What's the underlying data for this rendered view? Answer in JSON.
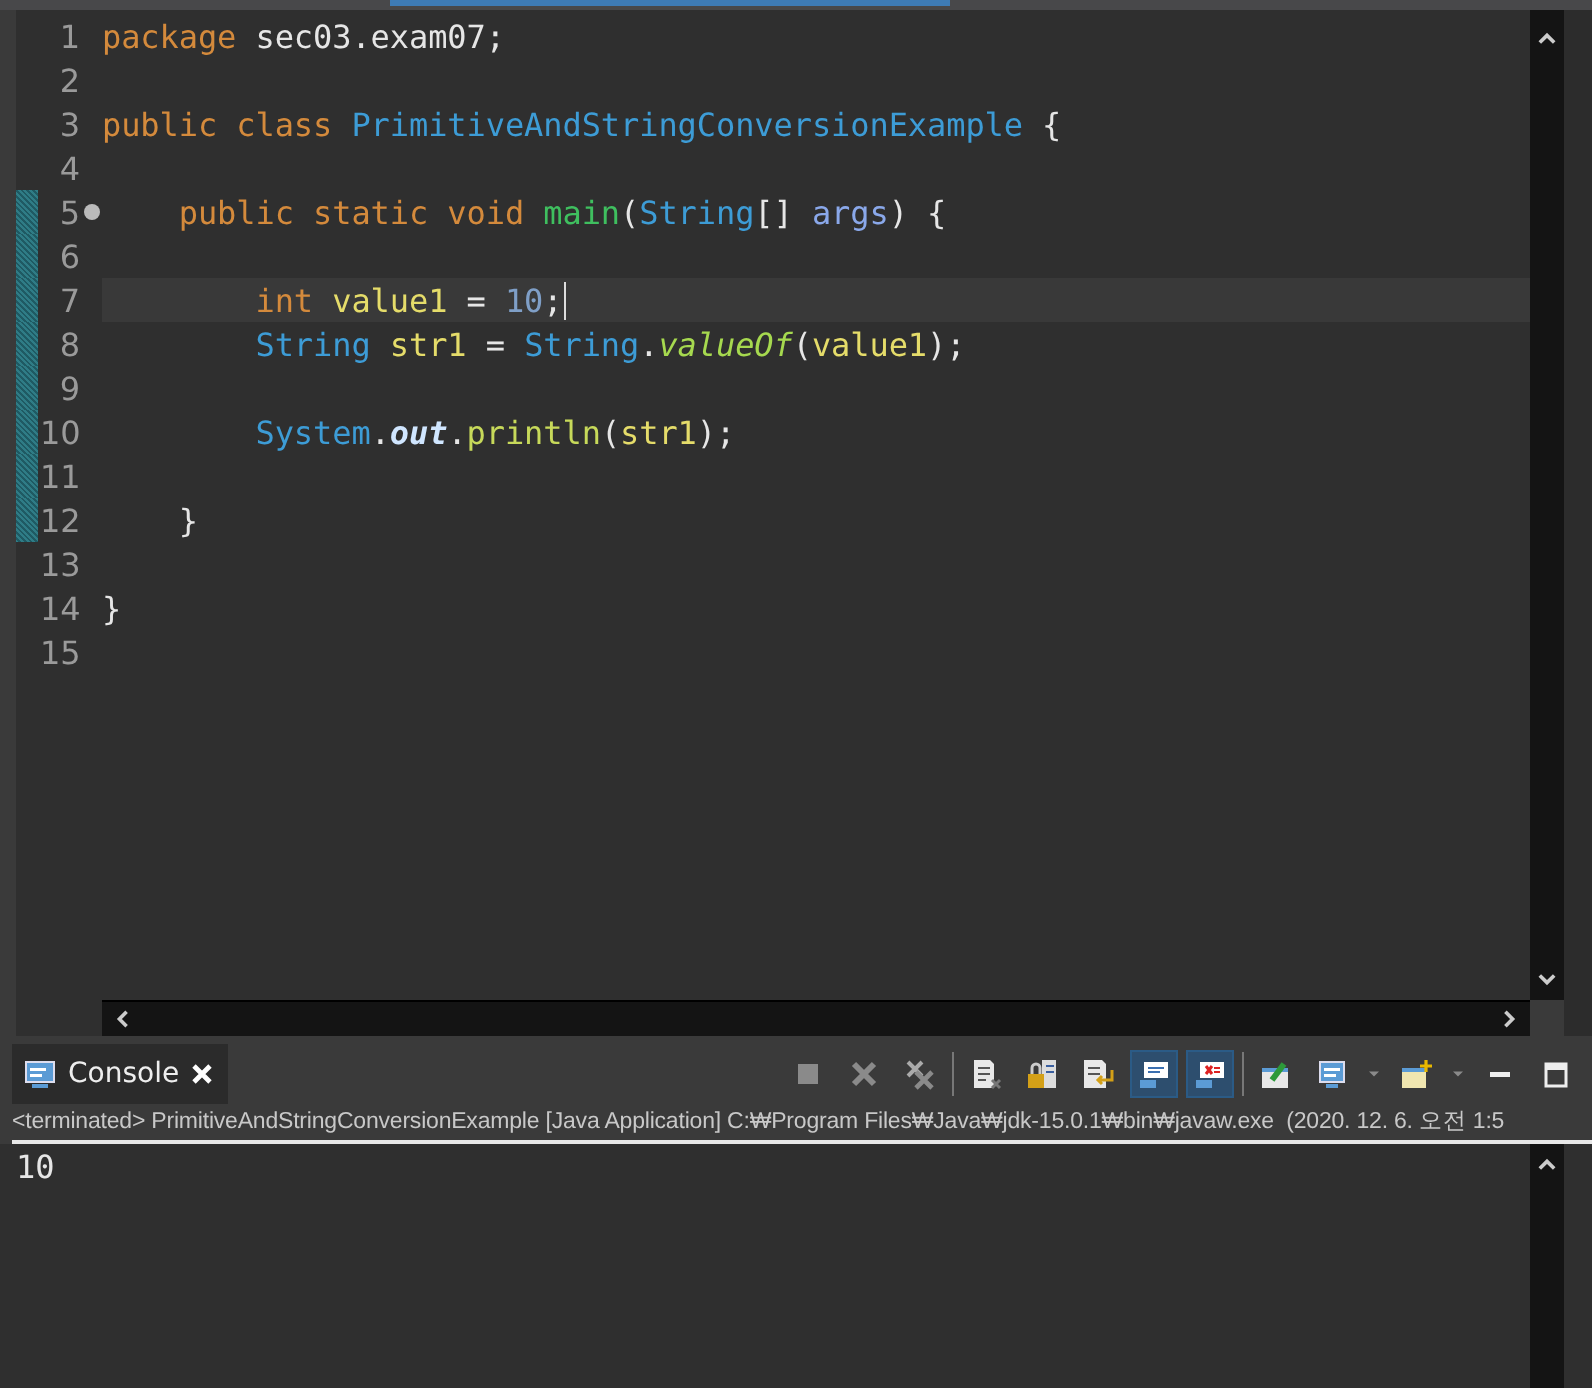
{
  "editor": {
    "lines": [
      {
        "number": "1",
        "changed": false,
        "current": false,
        "foldable": false,
        "tokens": [
          {
            "kind": "keyword",
            "text": "package"
          },
          {
            "kind": "plain",
            "text": " sec03.exam07;"
          }
        ]
      },
      {
        "number": "2",
        "changed": false,
        "current": false,
        "foldable": false
      },
      {
        "number": "3",
        "changed": false,
        "current": false,
        "foldable": false,
        "tokens": [
          {
            "kind": "keyword",
            "text": "public class "
          },
          {
            "kind": "type",
            "text": "PrimitiveAndStringConversionExample"
          },
          {
            "kind": "plain",
            "text": " {"
          }
        ]
      },
      {
        "number": "4",
        "changed": false,
        "current": false,
        "foldable": false
      },
      {
        "number": "5",
        "changed": true,
        "current": false,
        "foldable": true,
        "tokens": [
          {
            "kind": "keyword",
            "text": "    public static void "
          },
          {
            "kind": "method_decl",
            "text": "main"
          },
          {
            "kind": "plain",
            "text": "("
          },
          {
            "kind": "type",
            "text": "String"
          },
          {
            "kind": "plain",
            "text": "[] "
          },
          {
            "kind": "param",
            "text": "args"
          },
          {
            "kind": "plain",
            "text": ") {"
          }
        ]
      },
      {
        "number": "6",
        "changed": true,
        "current": false,
        "foldable": false
      },
      {
        "number": "7",
        "changed": true,
        "current": true,
        "foldable": false,
        "tokens": [
          {
            "kind": "keyword",
            "text": "        int "
          },
          {
            "kind": "local",
            "text": "value1"
          },
          {
            "kind": "plain",
            "text": " = "
          },
          {
            "kind": "number",
            "text": "10"
          },
          {
            "kind": "plain",
            "text": ";"
          }
        ]
      },
      {
        "number": "8",
        "changed": true,
        "current": false,
        "foldable": false,
        "tokens": [
          {
            "kind": "type",
            "text": "        String "
          },
          {
            "kind": "local",
            "text": "str1"
          },
          {
            "kind": "plain",
            "text": " = "
          },
          {
            "kind": "type",
            "text": "String"
          },
          {
            "kind": "plain",
            "text": "."
          },
          {
            "kind": "static_method",
            "text": "valueOf"
          },
          {
            "kind": "plain",
            "text": "("
          },
          {
            "kind": "local",
            "text": "value1"
          },
          {
            "kind": "plain",
            "text": ");"
          }
        ]
      },
      {
        "number": "9",
        "changed": true,
        "current": false,
        "foldable": false
      },
      {
        "number": "10",
        "changed": true,
        "current": false,
        "foldable": false,
        "tokens": [
          {
            "kind": "type",
            "text": "        System"
          },
          {
            "kind": "plain",
            "text": "."
          },
          {
            "kind": "static_field",
            "text": "out"
          },
          {
            "kind": "plain",
            "text": "."
          },
          {
            "kind": "method",
            "text": "println"
          },
          {
            "kind": "plain",
            "text": "("
          },
          {
            "kind": "local",
            "text": "str1"
          },
          {
            "kind": "plain",
            "text": ");"
          }
        ]
      },
      {
        "number": "11",
        "changed": true,
        "current": false,
        "foldable": false
      },
      {
        "number": "12",
        "changed": true,
        "current": false,
        "foldable": false,
        "tokens": [
          {
            "kind": "plain",
            "text": "    }"
          }
        ]
      },
      {
        "number": "13",
        "changed": false,
        "current": false,
        "foldable": false
      },
      {
        "number": "14",
        "changed": false,
        "current": false,
        "foldable": false,
        "tokens": [
          {
            "kind": "plain",
            "text": "}"
          }
        ]
      },
      {
        "number": "15",
        "changed": false,
        "current": false,
        "foldable": false
      }
    ]
  },
  "console": {
    "tab": {
      "label": "Console",
      "selected": true
    },
    "toolbar": [
      {
        "kind": "stop",
        "pressed": false
      },
      {
        "kind": "remove",
        "pressed": false
      },
      {
        "kind": "remove_all",
        "pressed": false
      },
      {
        "kind": "sep",
        "pressed": false
      },
      {
        "kind": "scroll_lock",
        "pressed": false
      },
      {
        "kind": "lock",
        "pressed": false
      },
      {
        "kind": "word_wrap",
        "pressed": false
      },
      {
        "kind": "show_out",
        "pressed": true
      },
      {
        "kind": "show_err",
        "pressed": true
      },
      {
        "kind": "sep",
        "pressed": false
      },
      {
        "kind": "pin",
        "pressed": false
      },
      {
        "kind": "display",
        "pressed": false
      },
      {
        "kind": "caret",
        "pressed": false
      },
      {
        "kind": "new",
        "pressed": false
      },
      {
        "kind": "caret",
        "pressed": false
      },
      {
        "kind": "minimize",
        "pressed": false
      },
      {
        "kind": "maximize",
        "pressed": false
      }
    ],
    "description": "<terminated> PrimitiveAndStringConversionExample [Java Application] C:₩Program Files₩Java₩jdk-15.0.1₩bin₩javaw.exe  (2020. 12. 6. 오전 1:5",
    "output": [
      "10"
    ]
  }
}
